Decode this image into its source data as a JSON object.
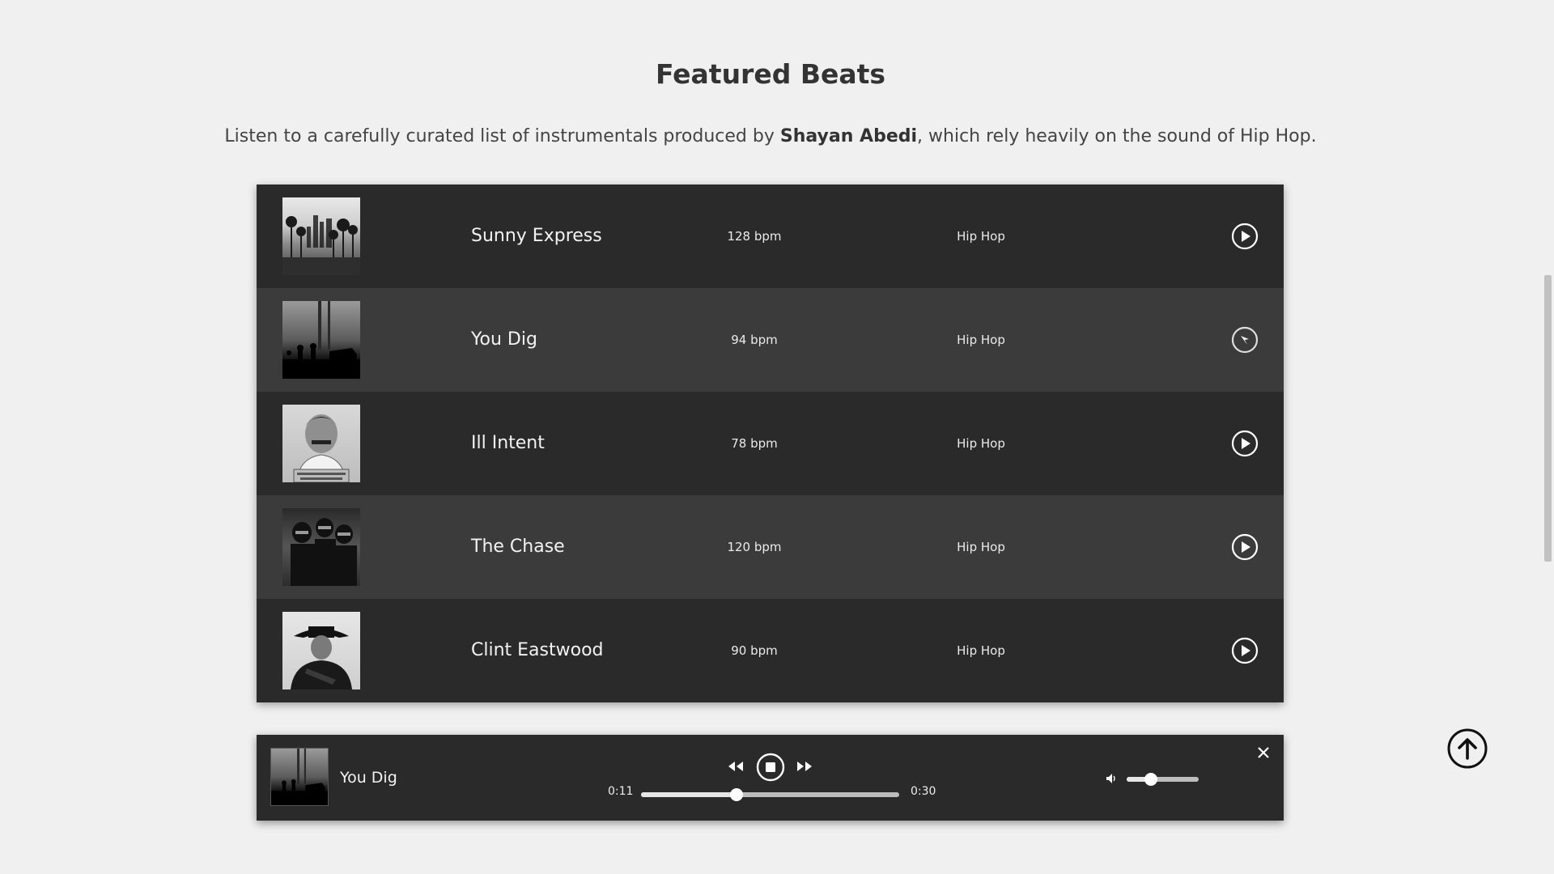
{
  "section": {
    "title": "Featured Beats",
    "subtitle_pre": "Listen to a carefully curated list of instrumentals produced by ",
    "subtitle_name": "Shayan Abedi",
    "subtitle_post": ", which rely heavily on the sound of Hip Hop."
  },
  "beats": [
    {
      "name": "Sunny Express",
      "bpm": "128 bpm",
      "genre": "Hip Hop"
    },
    {
      "name": "You Dig",
      "bpm": "94 bpm",
      "genre": "Hip Hop"
    },
    {
      "name": "Ill Intent",
      "bpm": "78 bpm",
      "genre": "Hip Hop"
    },
    {
      "name": "The Chase",
      "bpm": "120 bpm",
      "genre": "Hip Hop"
    },
    {
      "name": "Clint Eastwood",
      "bpm": "90 bpm",
      "genre": "Hip Hop"
    }
  ],
  "player": {
    "title": "You Dig",
    "current_time": "0:11",
    "duration": "0:30",
    "progress": 0.37,
    "volume": 0.34
  },
  "icons": {
    "play": "play-circle-icon",
    "stop": "stop-circle-icon",
    "rewind": "rewind-icon",
    "forward": "fast-forward-icon",
    "volume": "volume-icon",
    "close": "close-icon",
    "scroll_top": "arrow-up-circle-icon"
  }
}
